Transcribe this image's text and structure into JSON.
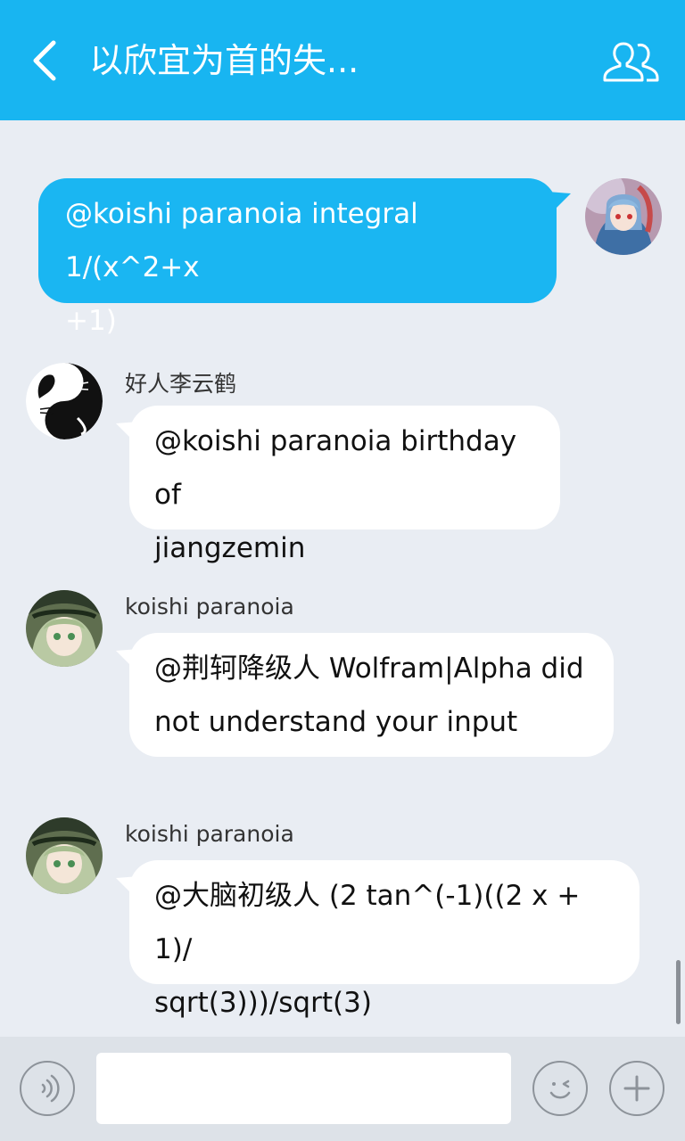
{
  "header": {
    "title": "以欣宜为首的失...",
    "back_icon": "chevron-left-icon",
    "group_icon": "group-members-icon",
    "bg_color": "#18b5f1"
  },
  "messages": [
    {
      "direction": "outgoing",
      "sender": "",
      "lines": [
        "@koishi paranoia integral 1/(x^2+x",
        "+1)"
      ]
    },
    {
      "direction": "incoming",
      "sender": "好人李云鹤",
      "lines": [
        "@koishi paranoia birthday of",
        "jiangzemin"
      ]
    },
    {
      "direction": "incoming",
      "sender": "koishi paranoia",
      "lines": [
        "@荆轲降级人 Wolfram|Alpha did",
        "not understand your input"
      ]
    },
    {
      "direction": "incoming",
      "sender": "koishi paranoia",
      "lines": [
        "@大脑初级人 (2 tan^(-1)((2 x + 1)/",
        "sqrt(3)))/sqrt(3)"
      ]
    }
  ],
  "input_bar": {
    "voice_icon": "voice-icon",
    "emoji_icon": "emoji-icon",
    "plus_icon": "plus-icon",
    "text_value": ""
  },
  "colors": {
    "outgoing_bubble": "#1ab6f2",
    "incoming_bubble": "#ffffff",
    "chat_bg": "#e9edf3"
  }
}
